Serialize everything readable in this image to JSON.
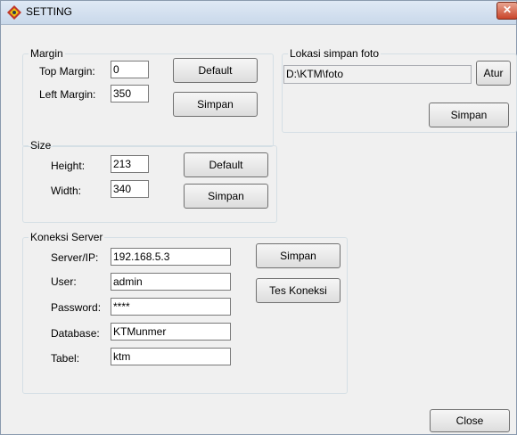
{
  "window": {
    "title": "SETTING",
    "close_glyph": "✕"
  },
  "margin": {
    "legend": "Margin",
    "top_label": "Top Margin:",
    "top_value": "0",
    "left_label": "Left Margin:",
    "left_value": "350",
    "default_label": "Default",
    "save_label": "Simpan"
  },
  "lokasi": {
    "legend": "Lokasi simpan foto",
    "path_value": "D:\\KTM\\foto",
    "browse_label": "Atur",
    "save_label": "Simpan"
  },
  "size": {
    "legend": "Size",
    "height_label": "Height:",
    "height_value": "213",
    "width_label": "Width:",
    "width_value": "340",
    "default_label": "Default",
    "save_label": "Simpan"
  },
  "server": {
    "legend": "Koneksi Server",
    "fields": [
      {
        "label": "Server/IP:",
        "value": "192.168.5.3"
      },
      {
        "label": "User:",
        "value": "admin"
      },
      {
        "label": "Password:",
        "value": "****"
      },
      {
        "label": "Database:",
        "value": "KTMunmer"
      },
      {
        "label": "Tabel:",
        "value": "ktm"
      }
    ],
    "save_label": "Simpan",
    "test_label": "Tes Koneksi"
  },
  "footer": {
    "close_label": "Close"
  }
}
